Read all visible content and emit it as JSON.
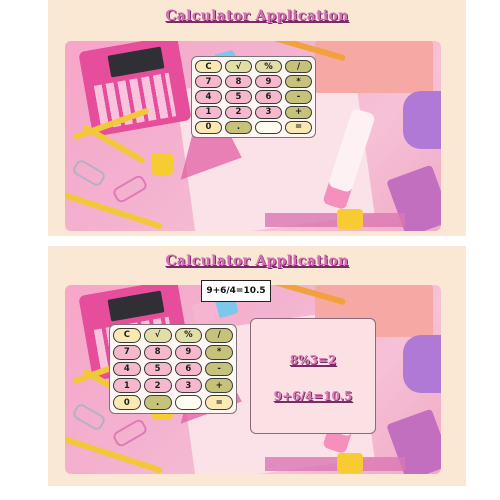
{
  "screens": [
    {
      "title": "Calculator Application",
      "keys": [
        {
          "label": "C",
          "style": "light"
        },
        {
          "label": "√",
          "style": "func"
        },
        {
          "label": "%",
          "style": "func"
        },
        {
          "label": "/",
          "style": "op"
        },
        {
          "label": "7",
          "style": "num"
        },
        {
          "label": "8",
          "style": "num"
        },
        {
          "label": "9",
          "style": "num"
        },
        {
          "label": "*",
          "style": "op"
        },
        {
          "label": "4",
          "style": "num"
        },
        {
          "label": "5",
          "style": "num"
        },
        {
          "label": "6",
          "style": "num"
        },
        {
          "label": "-",
          "style": "op"
        },
        {
          "label": "1",
          "style": "num"
        },
        {
          "label": "2",
          "style": "num"
        },
        {
          "label": "3",
          "style": "num"
        },
        {
          "label": "+",
          "style": "op"
        },
        {
          "label": "0",
          "style": "light"
        },
        {
          "label": ".",
          "style": "op"
        },
        {
          "label": "",
          "style": "blank"
        },
        {
          "label": "=",
          "style": "light"
        }
      ]
    },
    {
      "title": "Calculator Application",
      "display": "9+6/4=10.5",
      "history": [
        "8%3=2",
        "9+6/4=10.5"
      ],
      "keys": [
        {
          "label": "C",
          "style": "light"
        },
        {
          "label": "√",
          "style": "func"
        },
        {
          "label": "%",
          "style": "func"
        },
        {
          "label": "/",
          "style": "op"
        },
        {
          "label": "7",
          "style": "num"
        },
        {
          "label": "8",
          "style": "num"
        },
        {
          "label": "9",
          "style": "num"
        },
        {
          "label": "*",
          "style": "op"
        },
        {
          "label": "4",
          "style": "num"
        },
        {
          "label": "5",
          "style": "num"
        },
        {
          "label": "6",
          "style": "num"
        },
        {
          "label": "-",
          "style": "op"
        },
        {
          "label": "1",
          "style": "num"
        },
        {
          "label": "2",
          "style": "num"
        },
        {
          "label": "3",
          "style": "num"
        },
        {
          "label": "+",
          "style": "op"
        },
        {
          "label": "0",
          "style": "light"
        },
        {
          "label": ".",
          "style": "op"
        },
        {
          "label": "",
          "style": "blank"
        },
        {
          "label": "=",
          "style": "light"
        }
      ]
    }
  ],
  "colors": {
    "panel_background": "#fbe8d4",
    "title_pink": "#d36db6",
    "key_number": "#f5b8cc",
    "key_operator": "#c7c27a",
    "key_function": "#e2dfa6",
    "key_light": "#fbe9b4"
  }
}
